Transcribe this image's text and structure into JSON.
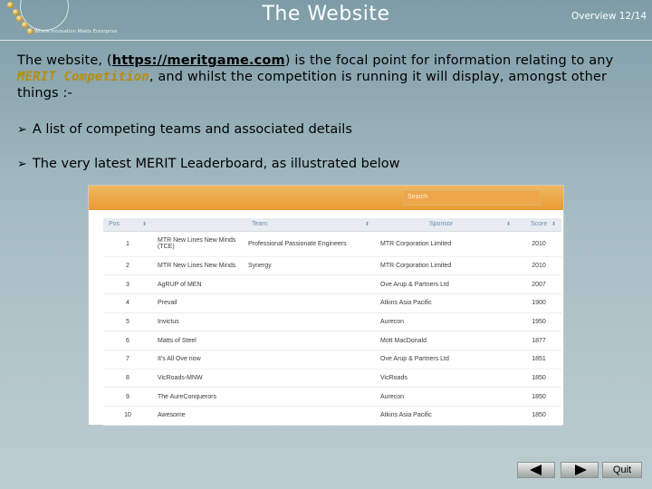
{
  "header": {
    "logo_text": "Where Innovation Meets Enterprise",
    "title": "The Website",
    "overview": "Overview 12/14"
  },
  "intro": {
    "pre": "The website, (",
    "link": "https://meritgame.com",
    "mid": ") is the focal point for information relating to any ",
    "competition": "MERIT Competition",
    "post": ", and whilst the competition is running it will display, amongst other things :-"
  },
  "bullets": [
    "A list of competing teams and associated details",
    "The very latest MERIT Leaderboard, as illustrated below"
  ],
  "leaderboard": {
    "search_placeholder": "Search",
    "columns": [
      "Pos",
      "Team",
      "Sponsor",
      "Score"
    ],
    "rows": [
      {
        "pos": "1",
        "team": "MTR New Lines New Minds (TCE)",
        "team_sub": "Professional Passionate Engineers",
        "sponsor": "MTR Corporation Limited",
        "score": "2010"
      },
      {
        "pos": "2",
        "team": "MTR New Lines New Minds",
        "team_sub": "Synergy",
        "sponsor": "MTR Corporation Limited",
        "score": "2010"
      },
      {
        "pos": "3",
        "team": "AgRUP of MEN",
        "team_sub": "",
        "sponsor": "Ove Arup & Partners Ltd",
        "score": "2007"
      },
      {
        "pos": "4",
        "team": "Prevail",
        "team_sub": "",
        "sponsor": "Atkins Asia Pacific",
        "score": "1900"
      },
      {
        "pos": "5",
        "team": "Invictus",
        "team_sub": "",
        "sponsor": "Aurecon",
        "score": "1950"
      },
      {
        "pos": "6",
        "team": "Matts of Steel",
        "team_sub": "",
        "sponsor": "Mott MacDonald",
        "score": "1877"
      },
      {
        "pos": "7",
        "team": "It's All Ove now",
        "team_sub": "",
        "sponsor": "Ove Arup & Partners Ltd",
        "score": "1851"
      },
      {
        "pos": "8",
        "team": "VicRoads-MNW",
        "team_sub": "",
        "sponsor": "VicRoads",
        "score": "1850"
      },
      {
        "pos": "9",
        "team": "The AureConquerors",
        "team_sub": "",
        "sponsor": "Aurecon",
        "score": "1850"
      },
      {
        "pos": "10",
        "team": "Awesome",
        "team_sub": "",
        "sponsor": "Atkins Asia Pacific",
        "score": "1850"
      }
    ]
  },
  "nav": {
    "prev_icon": "left-triangle-icon",
    "next_icon": "right-triangle-icon",
    "quit_label": "Quit"
  },
  "colors": {
    "accent": "#b88d0c",
    "table_header_text": "#6c8db0",
    "banner": "#e99b31"
  }
}
